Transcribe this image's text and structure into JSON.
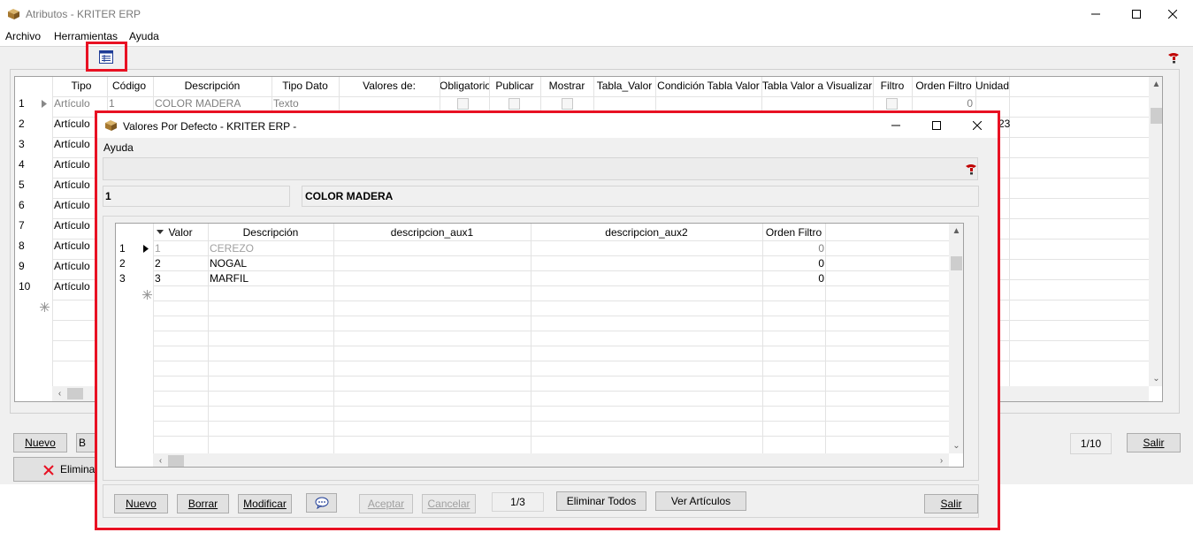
{
  "main": {
    "title": "Atributos - KRITER ERP",
    "menu": [
      "Archivo",
      "Herramientas",
      "Ayuda"
    ],
    "columns": [
      "Tipo",
      "Código",
      "Descripción",
      "Tipo Dato",
      "Valores de:",
      "Obligatorio",
      "Publicar",
      "Mostrar",
      "Tabla_Valor",
      "Condición Tabla Valor",
      "Tabla Valor a Visualizar",
      "Filtro",
      "Orden Filtro",
      "Unidad"
    ],
    "rows": [
      {
        "num": "1",
        "tipo": "Artículo",
        "codigo": "1",
        "descripcion": "COLOR MADERA",
        "tipo_dato": "Texto",
        "orden_filtro": "0"
      },
      {
        "num": "2",
        "tipo": "Artículo",
        "unidad": "23"
      },
      {
        "num": "3",
        "tipo": "Artículo"
      },
      {
        "num": "4",
        "tipo": "Artículo"
      },
      {
        "num": "5",
        "tipo": "Artículo"
      },
      {
        "num": "6",
        "tipo": "Artículo"
      },
      {
        "num": "7",
        "tipo": "Artículo"
      },
      {
        "num": "8",
        "tipo": "Artículo"
      },
      {
        "num": "9",
        "tipo": "Artículo"
      },
      {
        "num": "10",
        "tipo": "Artículo"
      }
    ],
    "buttons": {
      "nuevo": "Nuevo",
      "borrar_partial": "B",
      "eliminar": "Eliminar",
      "salir": "Salir"
    },
    "counter": "1/10"
  },
  "dialog": {
    "title": "Valores Por Defecto  - KRITER ERP -",
    "menu": "Ayuda",
    "code": "1",
    "description": "COLOR MADERA",
    "columns": [
      "Valor",
      "Descripción",
      "descripcion_aux1",
      "descripcion_aux2",
      "Orden Filtro"
    ],
    "rows": [
      {
        "num": "1",
        "valor": "1",
        "descripcion": "CEREZO",
        "orden": "0"
      },
      {
        "num": "2",
        "valor": "2",
        "descripcion": "NOGAL",
        "orden": "0"
      },
      {
        "num": "3",
        "valor": "3",
        "descripcion": "MARFIL",
        "orden": "0"
      }
    ],
    "buttons": {
      "nuevo": "Nuevo",
      "borrar": "Borrar",
      "modificar": "Modificar",
      "aceptar": "Aceptar",
      "cancelar": "Cancelar",
      "eliminar_todos": "Eliminar Todos",
      "ver_articulos": "Ver Artículos",
      "salir": "Salir"
    },
    "counter": "1/3"
  },
  "colors": {
    "highlight": "#e81123",
    "help_icon": "#c00000",
    "toolbar_icon": "#1e3c96"
  },
  "icons": [
    "package-icon",
    "minimize-icon",
    "maximize-icon",
    "close-icon",
    "help-icon",
    "grid-view-icon",
    "row-pointer-icon",
    "new-row-icon",
    "delete-x-icon",
    "comment-icon"
  ]
}
